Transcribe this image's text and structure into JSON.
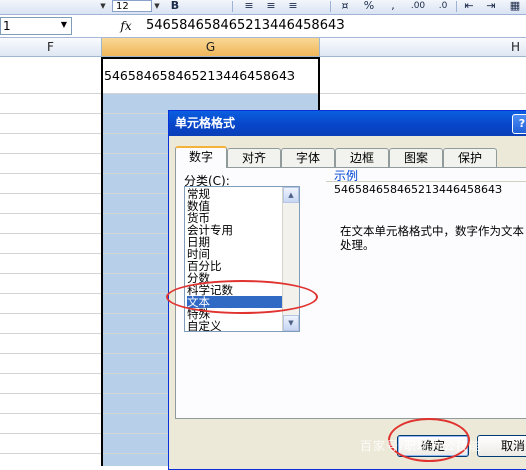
{
  "toolbar": {
    "font_size": "12",
    "bold_label": "B",
    "percent_label": "%",
    "comma_label": ",",
    "decimals_label": ".00",
    "align_icons": [
      "align-left-icon",
      "align-center-icon",
      "align-right-icon"
    ]
  },
  "formula_bar": {
    "name_box": "1",
    "fx": "fx",
    "content": "54658465846521344645864З"
  },
  "columns": [
    "F",
    "G",
    "H"
  ],
  "cell": {
    "value": "54658465846521344645864З"
  },
  "dialog": {
    "title": "单元格格式",
    "help": "?",
    "tabs": [
      "数字",
      "对齐",
      "字体",
      "边框",
      "图案",
      "保护"
    ],
    "active_tab": "数字",
    "category_label": "分类(C):",
    "categories": [
      "常规",
      "数值",
      "货币",
      "会计专用",
      "日期",
      "时间",
      "百分比",
      "分数",
      "科学记数",
      "文本",
      "特殊",
      "自定义"
    ],
    "selected_category": "文本",
    "sample_label": "示例",
    "sample_value": "54658465846521344645864З",
    "description": "在文本单元格格式中，数字作为文本处理。",
    "ok_label": "确定",
    "cancel_label": "取消"
  },
  "watermark": "百家号/职场办公技能"
}
